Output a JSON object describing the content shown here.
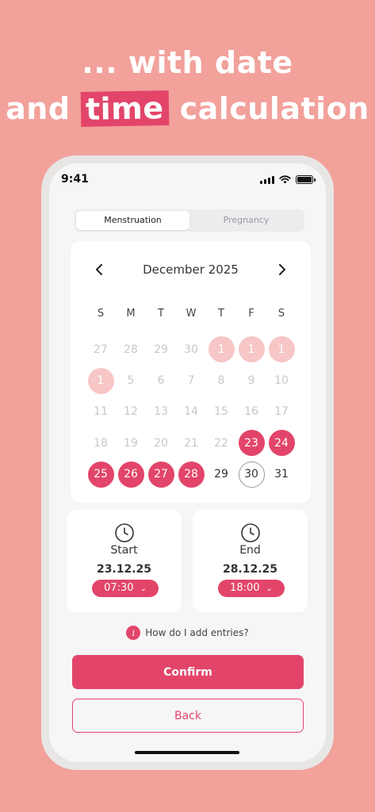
{
  "headline": {
    "line1": "... with date",
    "line2_before": "and",
    "line2_highlight": "time",
    "line2_after": "calculation"
  },
  "status_bar": {
    "time": "9:41"
  },
  "segment": {
    "tabs": [
      "Menstruation",
      "Pregnancy"
    ],
    "active": "Menstruation"
  },
  "calendar": {
    "month_label": "December 2025",
    "weekdays": [
      "S",
      "M",
      "T",
      "W",
      "T",
      "F",
      "S"
    ],
    "days": [
      {
        "n": "27",
        "state": "muted"
      },
      {
        "n": "28",
        "state": "muted"
      },
      {
        "n": "29",
        "state": "muted"
      },
      {
        "n": "30",
        "state": "muted"
      },
      {
        "n": "1",
        "state": "predicted"
      },
      {
        "n": "1",
        "state": "predicted"
      },
      {
        "n": "1",
        "state": "predicted"
      },
      {
        "n": "1",
        "state": "predicted"
      },
      {
        "n": "5",
        "state": "muted"
      },
      {
        "n": "6",
        "state": "muted"
      },
      {
        "n": "7",
        "state": "muted"
      },
      {
        "n": "8",
        "state": "muted"
      },
      {
        "n": "9",
        "state": "muted"
      },
      {
        "n": "10",
        "state": "muted"
      },
      {
        "n": "11",
        "state": "muted"
      },
      {
        "n": "12",
        "state": "muted"
      },
      {
        "n": "13",
        "state": "muted"
      },
      {
        "n": "14",
        "state": "muted"
      },
      {
        "n": "15",
        "state": "muted"
      },
      {
        "n": "16",
        "state": "muted"
      },
      {
        "n": "17",
        "state": "muted"
      },
      {
        "n": "18",
        "state": "muted"
      },
      {
        "n": "19",
        "state": "muted"
      },
      {
        "n": "20",
        "state": "muted"
      },
      {
        "n": "21",
        "state": "muted"
      },
      {
        "n": "22",
        "state": "muted"
      },
      {
        "n": "23",
        "state": "period"
      },
      {
        "n": "24",
        "state": "period"
      },
      {
        "n": "25",
        "state": "period"
      },
      {
        "n": "26",
        "state": "period"
      },
      {
        "n": "27",
        "state": "period"
      },
      {
        "n": "28",
        "state": "period"
      },
      {
        "n": "29",
        "state": "normal"
      },
      {
        "n": "30",
        "state": "today"
      },
      {
        "n": "31",
        "state": "normal"
      }
    ]
  },
  "start": {
    "label": "Start",
    "date": "23.12.25",
    "time": "07:30"
  },
  "end": {
    "label": "End",
    "date": "28.12.25",
    "time": "18:00"
  },
  "help": {
    "icon": "i",
    "text": "How do I add entries?"
  },
  "buttons": {
    "confirm": "Confirm",
    "back": "Back"
  },
  "colors": {
    "background": "#f2a19b",
    "accent": "#e3456a",
    "predicted": "#f7c6c6"
  }
}
